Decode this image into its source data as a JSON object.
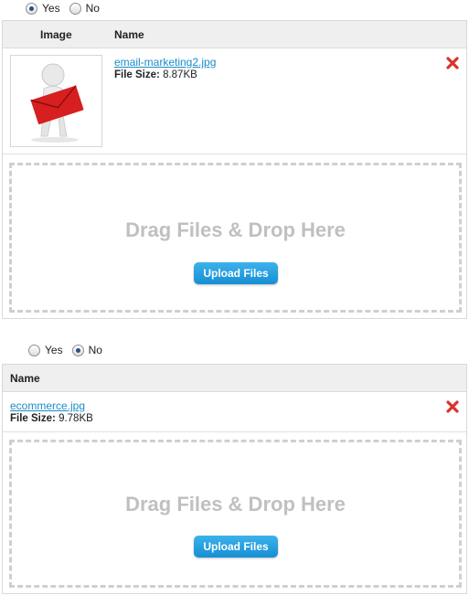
{
  "section1": {
    "radio": {
      "yes_label": "Yes",
      "no_label": "No",
      "selected": "Yes"
    },
    "table": {
      "col_image": "Image",
      "col_name": "Name",
      "file": {
        "name": "email-marketing2.jpg",
        "size_label": "File Size:",
        "size_value": "8.87KB"
      }
    },
    "dropzone": {
      "text": "Drag Files & Drop Here",
      "button_label": "Upload Files"
    }
  },
  "section2": {
    "radio": {
      "yes_label": "Yes",
      "no_label": "No",
      "selected": "No"
    },
    "table": {
      "col_name": "Name",
      "file": {
        "name": "ecommerce.jpg",
        "size_label": "File Size:",
        "size_value": "9.78KB"
      }
    },
    "dropzone": {
      "text": "Drag Files & Drop Here",
      "button_label": "Upload Files"
    }
  },
  "colors": {
    "accent": "#1a8cc9",
    "delete": "#d9332b",
    "button": "#1e9ce0"
  },
  "icons": {
    "delete": "x-icon",
    "thumbnail": "person-with-envelope-image"
  }
}
